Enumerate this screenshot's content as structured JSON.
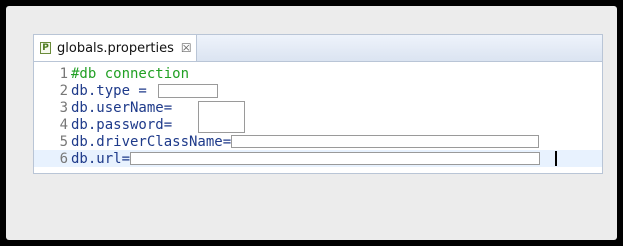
{
  "tab": {
    "icon_letter": "P",
    "title": "globals.properties",
    "close_glyph": "☒"
  },
  "lines": [
    {
      "num": "1",
      "text": "#db connection"
    },
    {
      "num": "2",
      "text": "db.type = "
    },
    {
      "num": "3",
      "text": "db.userName="
    },
    {
      "num": "4",
      "text": "db.password="
    },
    {
      "num": "5",
      "text": "db.driverClassName="
    },
    {
      "num": "6",
      "text": "db.url="
    }
  ]
}
